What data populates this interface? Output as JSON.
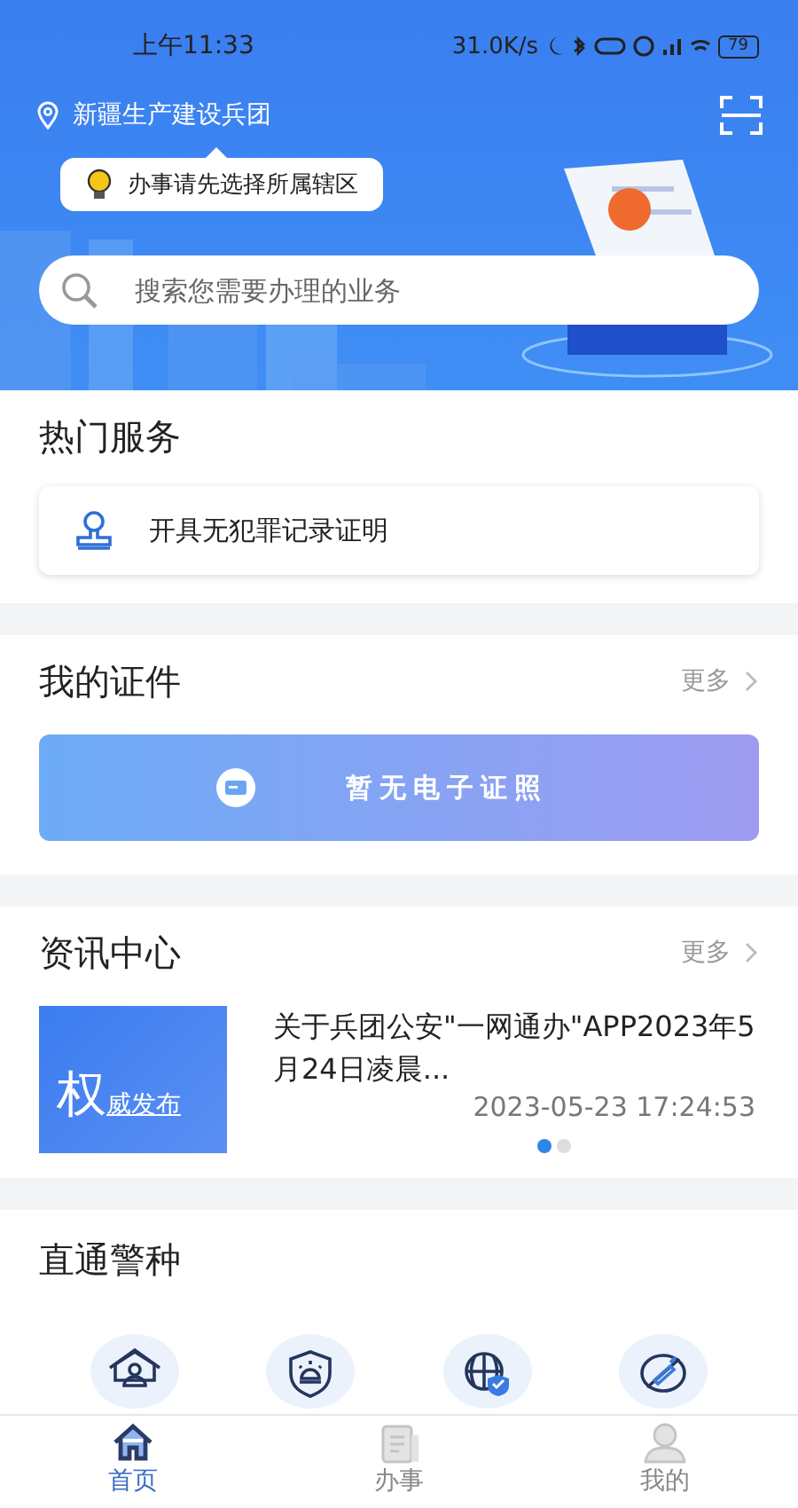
{
  "status_bar": {
    "time": "上午11:33",
    "speed": "31.0K/s",
    "battery": "79"
  },
  "header": {
    "location": "新疆生产建设兵团",
    "tooltip": "办事请先选择所属辖区",
    "search": {
      "placeholder": "搜索您需要办理的业务"
    }
  },
  "hot_services": {
    "title": "热门服务",
    "items": [
      {
        "label": "开具无犯罪记录证明"
      }
    ]
  },
  "certificates": {
    "title": "我的证件",
    "more": "更多",
    "empty": "暂无电子证照"
  },
  "news": {
    "title": "资讯中心",
    "more": "更多",
    "thumb_big": "权",
    "thumb_small": "威发布",
    "items": [
      {
        "title": "关于兵团公安\"一网通办\"APP2023年5月24日凌晨...",
        "time": "2023-05-23 17:24:53"
      }
    ],
    "pages": [
      {
        "selected": true
      },
      {
        "selected": false
      }
    ]
  },
  "police": {
    "title": "直通警种",
    "items": [
      {
        "kind": "house"
      },
      {
        "kind": "shield"
      },
      {
        "kind": "globe"
      },
      {
        "kind": "banned"
      }
    ]
  },
  "tabbar": [
    {
      "label": "首页",
      "kind": "home",
      "selected": true
    },
    {
      "label": "办事",
      "kind": "doc",
      "selected": false
    },
    {
      "label": "我的",
      "kind": "user",
      "selected": false
    }
  ]
}
